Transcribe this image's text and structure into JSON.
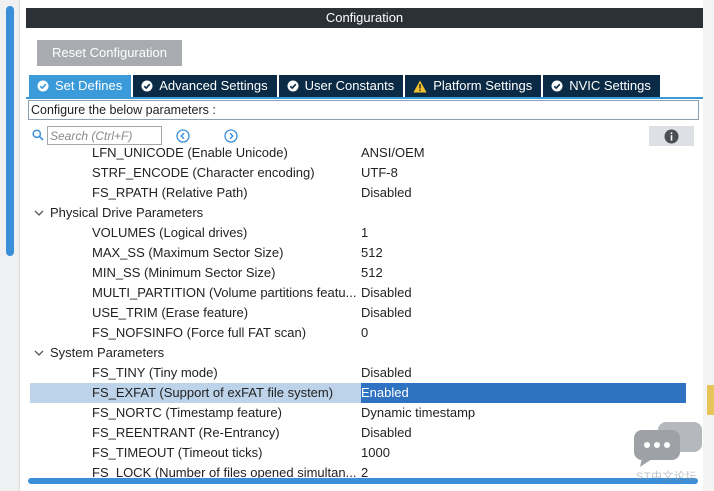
{
  "window": {
    "title": "Configuration"
  },
  "toolbar": {
    "reset_label": "Reset Configuration"
  },
  "tabs": [
    {
      "label": "Set Defines",
      "icon": "check-circle-icon",
      "active": true
    },
    {
      "label": "Advanced Settings",
      "icon": "check-circle-icon",
      "active": false
    },
    {
      "label": "User Constants",
      "icon": "check-circle-icon",
      "active": false
    },
    {
      "label": "Platform Settings",
      "icon": "warning-icon",
      "active": false
    },
    {
      "label": "NVIC Settings",
      "icon": "check-circle-icon",
      "active": false
    }
  ],
  "configure": {
    "text": "Configure the below parameters :"
  },
  "search": {
    "placeholder": "Search (Ctrl+F)"
  },
  "tree": [
    {
      "type": "param",
      "name": "LFN_UNICODE (Enable Unicode)",
      "value": "ANSI/OEM"
    },
    {
      "type": "param",
      "name": "STRF_ENCODE (Character encoding)",
      "value": "UTF-8"
    },
    {
      "type": "param",
      "name": "FS_RPATH (Relative Path)",
      "value": "Disabled"
    },
    {
      "type": "group",
      "name": "Physical Drive Parameters",
      "value": ""
    },
    {
      "type": "param",
      "name": "VOLUMES (Logical drives)",
      "value": "1"
    },
    {
      "type": "param",
      "name": "MAX_SS (Maximum Sector Size)",
      "value": "512"
    },
    {
      "type": "param",
      "name": "MIN_SS (Minimum Sector Size)",
      "value": "512"
    },
    {
      "type": "param",
      "name": "MULTI_PARTITION (Volume partitions featu...",
      "value": "Disabled"
    },
    {
      "type": "param",
      "name": "USE_TRIM (Erase feature)",
      "value": "Disabled"
    },
    {
      "type": "param",
      "name": "FS_NOFSINFO (Force full FAT scan)",
      "value": "0"
    },
    {
      "type": "group",
      "name": "System Parameters",
      "value": ""
    },
    {
      "type": "param",
      "name": "FS_TINY (Tiny mode)",
      "value": "Disabled"
    },
    {
      "type": "param",
      "name": "FS_EXFAT (Support of exFAT file system)",
      "value": "Enabled",
      "selected": true
    },
    {
      "type": "param",
      "name": "FS_NORTC (Timestamp feature)",
      "value": "Dynamic timestamp"
    },
    {
      "type": "param",
      "name": "FS_REENTRANT (Re-Entrancy)",
      "value": "Disabled"
    },
    {
      "type": "param",
      "name": "FS_TIMEOUT (Timeout ticks)",
      "value": "1000"
    },
    {
      "type": "param",
      "name": "FS_LOCK (Number of files opened simultan...",
      "value": "2"
    }
  ],
  "watermark": {
    "text": "ST中文论坛"
  },
  "colors": {
    "accent": "#3b9ad9",
    "tab_bg": "#0b2a45",
    "selection": "#bcd3ea",
    "selected_value": "#2f72c2"
  }
}
